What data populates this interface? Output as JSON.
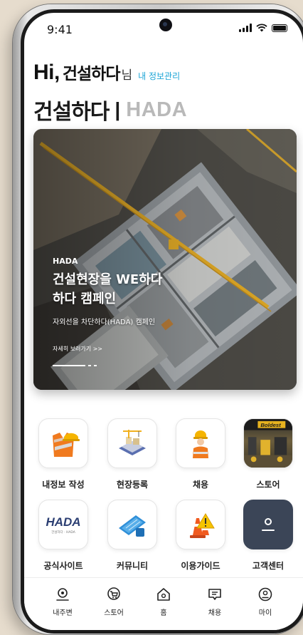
{
  "status": {
    "time": "9:41"
  },
  "greeting": {
    "hi": "Hi,",
    "name": "건설하다",
    "suffix": "님",
    "profile_link": "내 정보관리"
  },
  "brand": {
    "korean": "건설하다",
    "separator": "|",
    "english": "HADA"
  },
  "banner": {
    "tag": "HADA",
    "title_line1": "건설현장을 WE하다",
    "title_line2": "하다 캠페인",
    "subtitle": "자외선을 차단하다(HADA) 캠페인",
    "more_link": "자세히 보러가기 >>",
    "slide_count": 3,
    "active_slide": 1
  },
  "menu": {
    "items": [
      {
        "label": "내정보 작성",
        "icon": "safety-vest-helmet-icon"
      },
      {
        "label": "현장등록",
        "icon": "construction-site-icon"
      },
      {
        "label": "채용",
        "icon": "worker-icon"
      },
      {
        "label": "스토어",
        "icon": "store-photo-icon",
        "photo_text": "Boldest"
      },
      {
        "label": "공식사이트",
        "icon": "hada-logo-icon",
        "logo_text": "HADA",
        "logo_sub": "건설하다 · HADA"
      },
      {
        "label": "커뮤니티",
        "icon": "blueprint-icon"
      },
      {
        "label": "이용가이드",
        "icon": "traffic-cone-icon"
      },
      {
        "label": "고객센터",
        "icon": "person-icon"
      }
    ]
  },
  "tabbar": {
    "items": [
      {
        "label": "내주변",
        "icon": "location-icon"
      },
      {
        "label": "스토어",
        "icon": "cart-icon"
      },
      {
        "label": "홈",
        "icon": "home-icon"
      },
      {
        "label": "채용",
        "icon": "chat-icon"
      },
      {
        "label": "마이",
        "icon": "user-icon"
      }
    ]
  },
  "colors": {
    "accent": "#1aa4d6",
    "brand_gray": "#b9b9b9",
    "support_tile": "#3b4557"
  }
}
